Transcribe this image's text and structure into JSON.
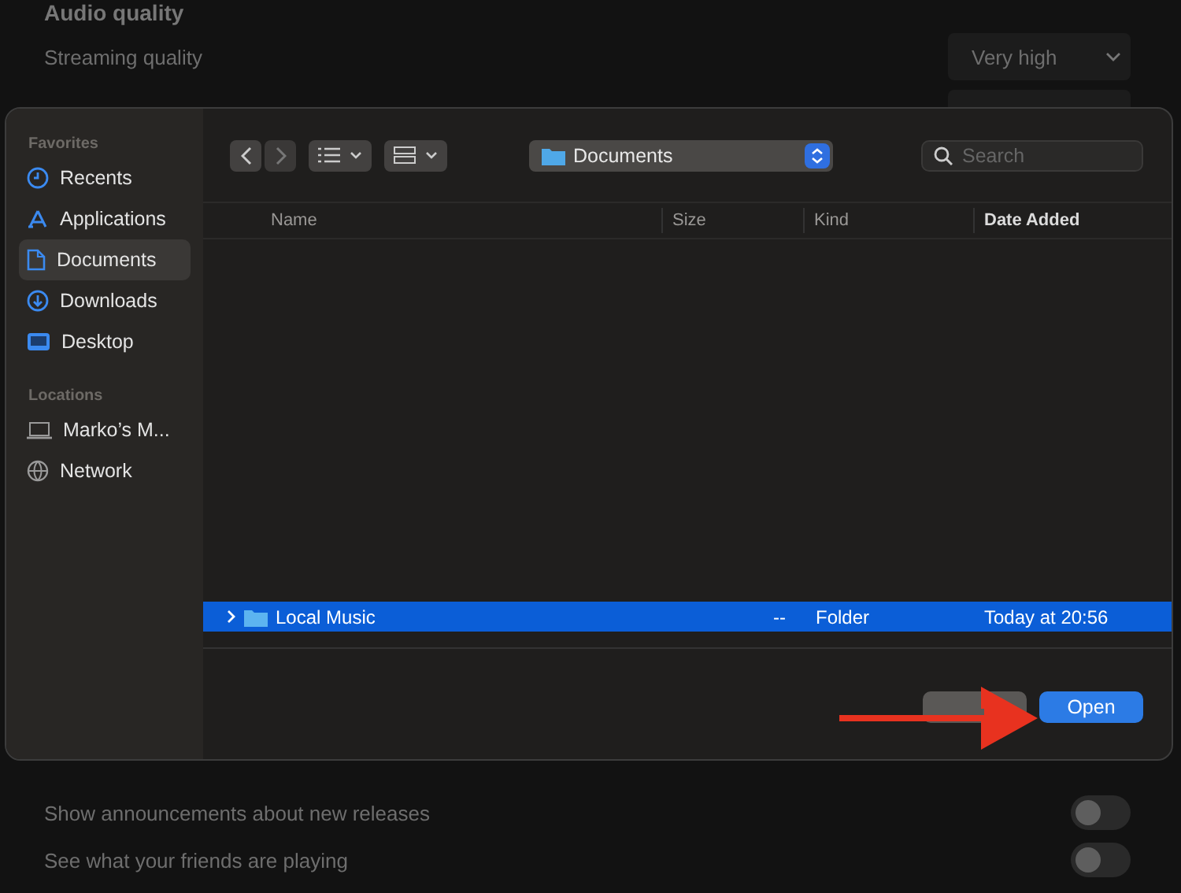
{
  "settings": {
    "heading": "Audio quality",
    "streaming": {
      "label": "Streaming quality",
      "value": "Very high"
    },
    "toggles": [
      {
        "label": "Show announcements about new releases",
        "on": false
      },
      {
        "label": "See what your friends are playing",
        "on": false
      }
    ]
  },
  "dialog": {
    "sidebar": [
      {
        "title": "Favorites",
        "items": [
          {
            "label": "Recents",
            "selected": false
          },
          {
            "label": "Applications",
            "selected": false
          },
          {
            "label": "Documents",
            "selected": true
          },
          {
            "label": "Downloads",
            "selected": false
          },
          {
            "label": "Desktop",
            "selected": false
          }
        ]
      },
      {
        "title": "Locations",
        "items": [
          {
            "label": "Marko’s M...",
            "selected": false
          },
          {
            "label": "Network",
            "selected": false
          }
        ]
      }
    ],
    "toolbar": {
      "location": "Documents",
      "search": {
        "placeholder": "Search"
      }
    },
    "columns": [
      {
        "label": "Name",
        "sorted": false
      },
      {
        "label": "Size",
        "sorted": false
      },
      {
        "label": "Kind",
        "sorted": false
      },
      {
        "label": "Date Added",
        "sorted": true
      }
    ],
    "rows": [
      {
        "name": "Local Music",
        "size": "--",
        "kind": "Folder",
        "date_added": "Today at 20:56",
        "selected": true,
        "expanded": false
      }
    ],
    "buttons": [
      {
        "kind": "cancel"
      },
      {
        "label": "Open",
        "kind": "default"
      }
    ]
  }
}
